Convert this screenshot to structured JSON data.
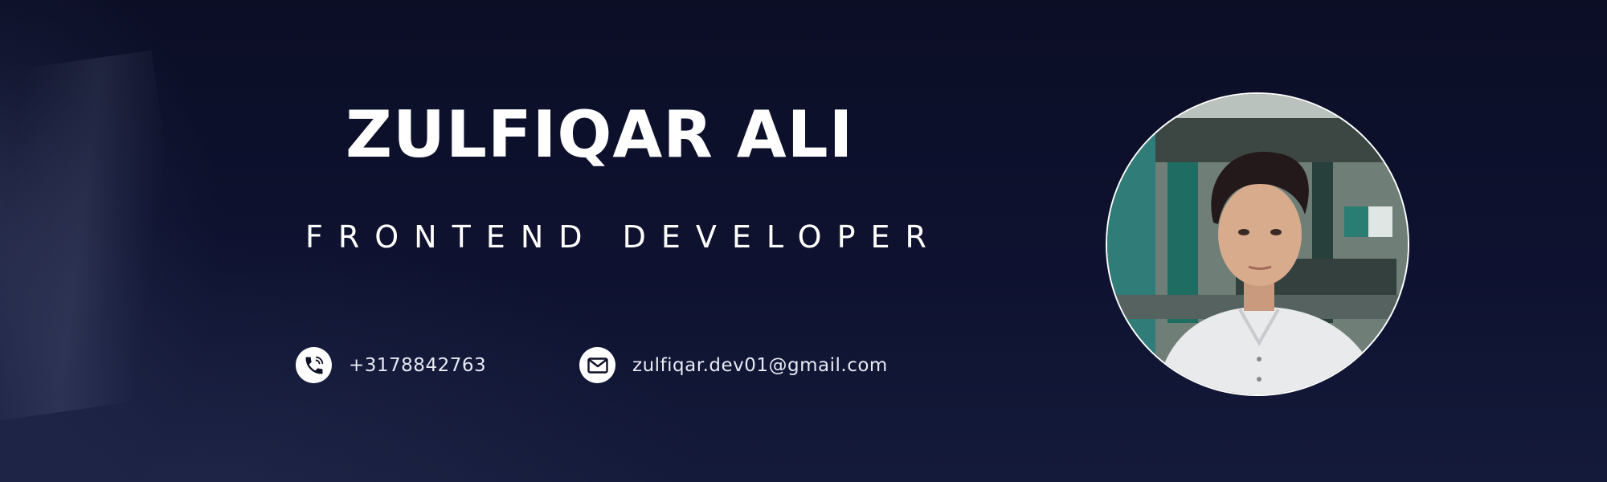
{
  "profile": {
    "name": "ZULFIQAR ALI",
    "title": "FRONTEND DEVELOPER"
  },
  "contacts": {
    "phone": {
      "icon": "phone-icon",
      "value": "+3178842763"
    },
    "email": {
      "icon": "envelope-icon",
      "value": "zulfiqar.dev01@gmail.com"
    }
  },
  "avatar": {
    "icon": "profile-photo"
  },
  "colors": {
    "background": "#0d1027",
    "text": "#ffffff",
    "icon_background": "#ffffff",
    "icon_foreground": "#0d1027"
  }
}
